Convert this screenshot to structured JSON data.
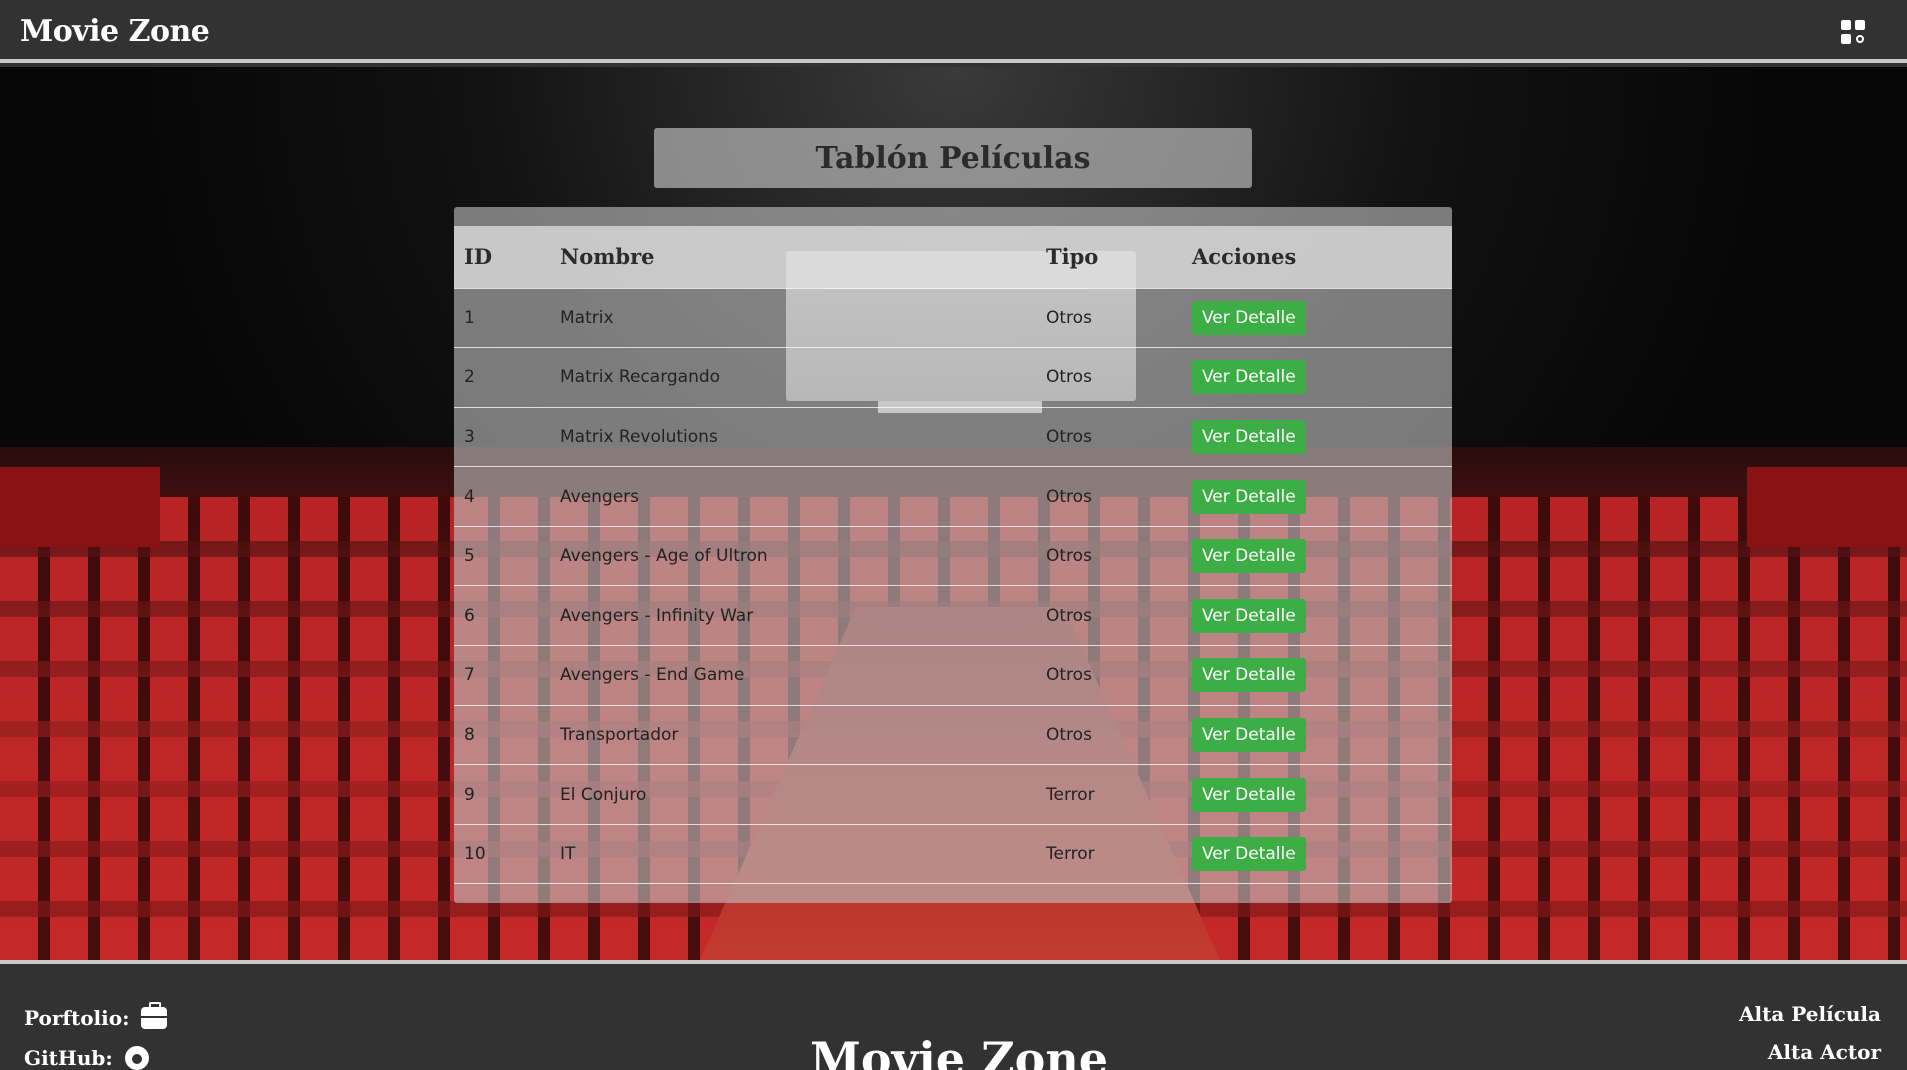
{
  "header": {
    "brand": "Movie Zone",
    "menu_icon": "grid-icon"
  },
  "page": {
    "title": "Tablón Películas"
  },
  "table": {
    "columns": [
      "ID",
      "Nombre",
      "Tipo",
      "Acciones"
    ],
    "rows": [
      {
        "id": "1",
        "nombre": "Matrix",
        "tipo": "Otros",
        "accion": "Ver Detalle"
      },
      {
        "id": "2",
        "nombre": "Matrix Recargando",
        "tipo": "Otros",
        "accion": "Ver Detalle"
      },
      {
        "id": "3",
        "nombre": "Matrix Revolutions",
        "tipo": "Otros",
        "accion": "Ver Detalle"
      },
      {
        "id": "4",
        "nombre": "Avengers",
        "tipo": "Otros",
        "accion": "Ver Detalle"
      },
      {
        "id": "5",
        "nombre": "Avengers - Age of Ultron",
        "tipo": "Otros",
        "accion": "Ver Detalle"
      },
      {
        "id": "6",
        "nombre": "Avengers - Infinity War",
        "tipo": "Otros",
        "accion": "Ver Detalle"
      },
      {
        "id": "7",
        "nombre": "Avengers - End Game",
        "tipo": "Otros",
        "accion": "Ver Detalle"
      },
      {
        "id": "8",
        "nombre": "Transportador",
        "tipo": "Otros",
        "accion": "Ver Detalle"
      },
      {
        "id": "9",
        "nombre": "El Conjuro",
        "tipo": "Terror",
        "accion": "Ver Detalle"
      },
      {
        "id": "10",
        "nombre": "IT",
        "tipo": "Terror",
        "accion": "Ver Detalle"
      }
    ],
    "button_color": "#3dae46"
  },
  "footer": {
    "portfolio_label": "Porftolio:",
    "github_label": "GitHub:",
    "brand": "Movie Zone",
    "alta_pelicula": "Alta Película",
    "alta_actor": "Alta Actor"
  }
}
